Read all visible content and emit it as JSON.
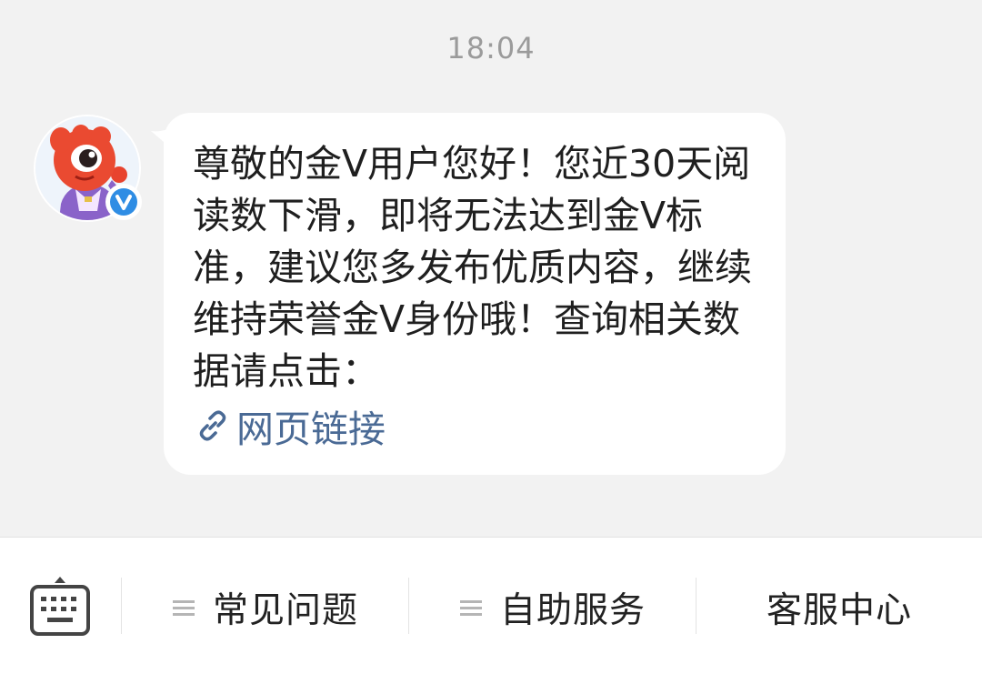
{
  "chat": {
    "timestamp": "18:04",
    "sender": {
      "avatar_icon": "weibo-mascot-avatar",
      "badge_icon": "verified-v-badge",
      "badge_color": "#2f8de4"
    },
    "message": {
      "text": "尊敬的金V用户您好！您近30天阅读数下滑，即将无法达到金V标准，建议您多发布优质内容，继续维持荣誉金V身份哦！查询相关数据请点击：",
      "link_icon": "link-icon",
      "link_label": "网页链接",
      "link_color": "#4a6a95"
    }
  },
  "bottom_bar": {
    "keyboard_icon": "keyboard-icon",
    "menus": [
      {
        "label": "常见问题",
        "icon": "menu-lines-icon"
      },
      {
        "label": "自助服务",
        "icon": "menu-lines-icon"
      },
      {
        "label": "客服中心",
        "icon": ""
      }
    ]
  },
  "colors": {
    "background": "#f2f2f2",
    "bubble": "#ffffff",
    "text": "#1f1f1f",
    "timestamp": "#9b9b9b"
  }
}
